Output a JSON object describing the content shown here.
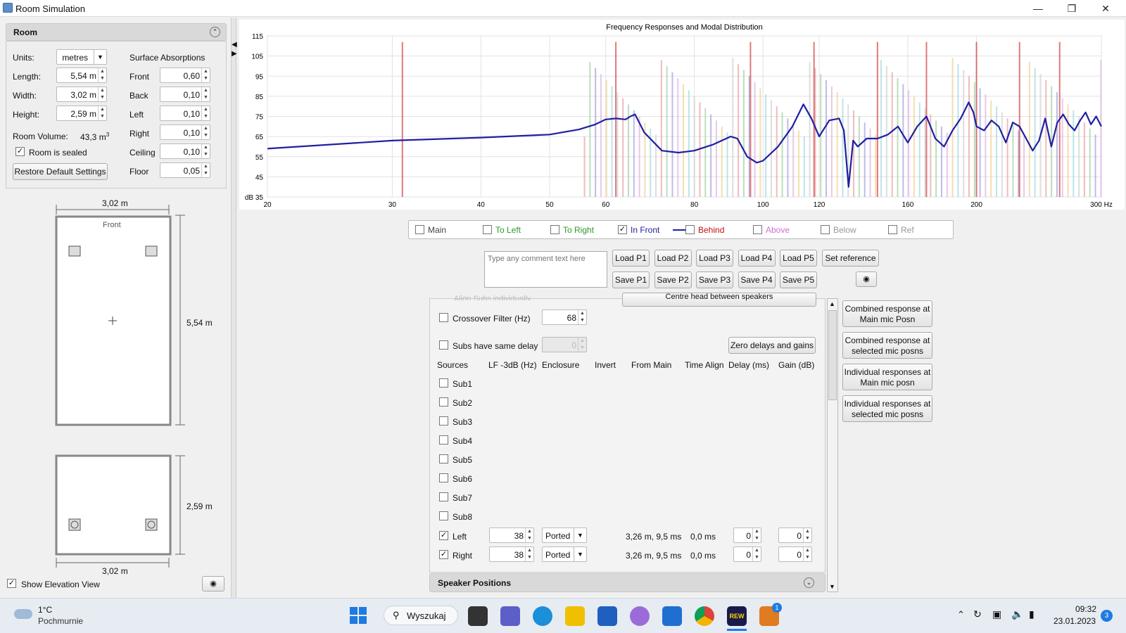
{
  "window": {
    "title": "Room Simulation"
  },
  "room": {
    "header": "Room",
    "units_label": "Units:",
    "units_value": "metres",
    "length_label": "Length:",
    "length_value": "5,54 m",
    "width_label": "Width:",
    "width_value": "3,02 m",
    "height_label": "Height:",
    "height_value": "2,59 m",
    "volume_label": "Room Volume:",
    "volume_value": "43,3 m",
    "volume_sup": "3",
    "sealed_label": "Room is sealed",
    "sealed_checked": true,
    "restore_label": "Restore Default Settings",
    "absorption_title": "Surface Absorptions",
    "absorptions": [
      {
        "label": "Front",
        "value": "0,60"
      },
      {
        "label": "Back",
        "value": "0,10"
      },
      {
        "label": "Left",
        "value": "0,10"
      },
      {
        "label": "Right",
        "value": "0,10"
      },
      {
        "label": "Ceiling",
        "value": "0,10"
      },
      {
        "label": "Floor",
        "value": "0,05"
      }
    ]
  },
  "plan": {
    "width_label": "3,02 m",
    "length_label": "5,54 m",
    "front_label": "Front"
  },
  "elevation": {
    "height_label": "2,59 m",
    "width_label": "3,02 m"
  },
  "show_elevation": {
    "label": "Show Elevation View",
    "checked": true
  },
  "chart_data": {
    "type": "line",
    "title": "Frequency Responses and Modal Distribution",
    "ylabel": "dB",
    "x_scale": "log",
    "xlim": [
      20,
      300
    ],
    "ylim": [
      35,
      115
    ],
    "x_ticks": [
      "20",
      "30",
      "40",
      "50",
      "60",
      "80",
      "100",
      "120",
      "160",
      "200",
      "300 Hz"
    ],
    "x_tick_values": [
      20,
      30,
      40,
      50,
      60,
      80,
      100,
      120,
      160,
      200,
      300
    ],
    "y_ticks": [
      115,
      105,
      95,
      85,
      75,
      65,
      55,
      45,
      35
    ],
    "y_tick_labels": [
      "115",
      "105",
      "95",
      "85",
      "75",
      "65",
      "55",
      "45",
      "dB 35"
    ],
    "grid": true,
    "series": [
      {
        "name": "In Front",
        "color": "#2020a0",
        "x": [
          20,
          30,
          40,
          50,
          55,
          58,
          60,
          62,
          64,
          65,
          66,
          68,
          72,
          76,
          80,
          85,
          90,
          92,
          95,
          98,
          100,
          105,
          110,
          114,
          117,
          120,
          124,
          128,
          130,
          132,
          134,
          136,
          140,
          145,
          150,
          155,
          160,
          165,
          170,
          175,
          180,
          185,
          190,
          195,
          198,
          200,
          205,
          210,
          215,
          220,
          225,
          230,
          235,
          240,
          245,
          250,
          255,
          260,
          265,
          270,
          275,
          280,
          285,
          290,
          295,
          300
        ],
        "y": [
          59,
          63,
          64.5,
          66,
          68.5,
          71,
          73.5,
          74,
          73.5,
          75,
          76,
          67,
          58,
          57,
          58,
          61,
          65,
          64,
          55,
          52,
          53,
          60,
          70,
          81,
          74,
          65,
          73,
          74,
          68,
          40,
          63,
          60,
          64,
          64,
          66,
          70,
          62,
          70,
          75,
          64,
          60,
          68,
          74,
          82,
          77,
          70,
          68,
          73,
          70,
          62,
          72,
          70,
          64,
          58,
          63,
          74,
          60,
          72,
          76,
          71,
          68,
          73,
          77,
          71,
          75,
          70
        ]
      },
      {
        "name": "Modes",
        "color": "#cc3333",
        "x": [
          31,
          62,
          96,
          118,
          145,
          170,
          200,
          230,
          262
        ],
        "y": [
          112,
          112,
          112,
          112,
          112,
          112,
          112,
          112,
          112
        ]
      }
    ]
  },
  "legend": [
    {
      "label": "Main",
      "checked": false,
      "color": "#444444"
    },
    {
      "label": "To Left",
      "checked": false,
      "color": "#2a9a2a"
    },
    {
      "label": "To Right",
      "checked": false,
      "color": "#2a9a2a"
    },
    {
      "label": "In Front",
      "checked": true,
      "color": "#2020a0"
    },
    {
      "label": "Behind",
      "checked": false,
      "color": "#c01010"
    },
    {
      "label": "Above",
      "checked": false,
      "color": "#d26ed2"
    },
    {
      "label": "Below",
      "checked": false,
      "color": "#999999"
    },
    {
      "label": "Ref",
      "checked": false,
      "color": "#999999"
    }
  ],
  "comment": {
    "placeholder": "Type any comment text here"
  },
  "load_buttons": [
    "Load P1",
    "Load P2",
    "Load P3",
    "Load P4",
    "Load P5"
  ],
  "save_buttons": [
    "Save P1",
    "Save P2",
    "Save P3",
    "Save P4",
    "Save P5"
  ],
  "set_reference": "Set reference",
  "subs": {
    "align_label": "Align Subs individually",
    "centre_head_label": "Centre head between speakers",
    "crossover_label": "Crossover Filter (Hz)",
    "crossover_value": "68",
    "same_delay_label": "Subs have same delay",
    "same_delay_value": "0",
    "zero_label": "Zero delays and gains",
    "columns": [
      "Sources",
      "LF -3dB (Hz)",
      "Enclosure",
      "Invert",
      "From Main",
      "Time Align",
      "Delay (ms)",
      "Gain (dB)"
    ],
    "sub_rows": [
      "Sub1",
      "Sub2",
      "Sub3",
      "Sub4",
      "Sub5",
      "Sub6",
      "Sub7",
      "Sub8"
    ],
    "speakers": [
      {
        "name": "Left",
        "checked": true,
        "lf": "38",
        "enclosure": "Ported",
        "from_main": "3,26 m, 9,5 ms",
        "time_align": "0,0 ms",
        "delay": "0",
        "gain": "0"
      },
      {
        "name": "Right",
        "checked": true,
        "lf": "38",
        "enclosure": "Ported",
        "from_main": "3,26 m, 9,5 ms",
        "time_align": "0,0 ms",
        "delay": "0",
        "gain": "0"
      }
    ]
  },
  "speaker_positions": "Speaker Positions",
  "side_buttons": [
    [
      "Combined response at",
      "Main mic Posn"
    ],
    [
      "Combined response at",
      "selected mic posns"
    ],
    [
      "Individual responses at",
      "Main mic posn"
    ],
    [
      "Individual responses at",
      "selected mic posns"
    ]
  ],
  "taskbar": {
    "weather_temp": "1°C",
    "weather_desc": "Pochmurnie",
    "search_label": "Wyszukaj",
    "time": "09:32",
    "date": "23.01.2023",
    "notif_count": "3",
    "badge_count": "1"
  }
}
